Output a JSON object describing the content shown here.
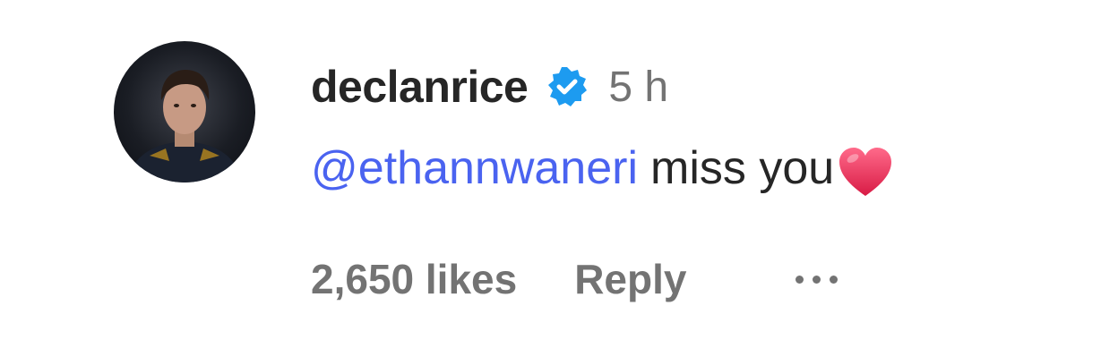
{
  "comment": {
    "username": "declanrice",
    "verified": true,
    "timestamp": "5 h",
    "mention": "@ethannwaneri",
    "text": "miss you",
    "emoji": "red-heart",
    "likes": "2,650 likes",
    "reply_label": "Reply",
    "more_icon": "more-horizontal-icon"
  },
  "colors": {
    "username": "#262626",
    "secondary": "#737373",
    "mention": "#4a63f0",
    "verified": "#1d9bf0",
    "heart": "#e8264f"
  }
}
